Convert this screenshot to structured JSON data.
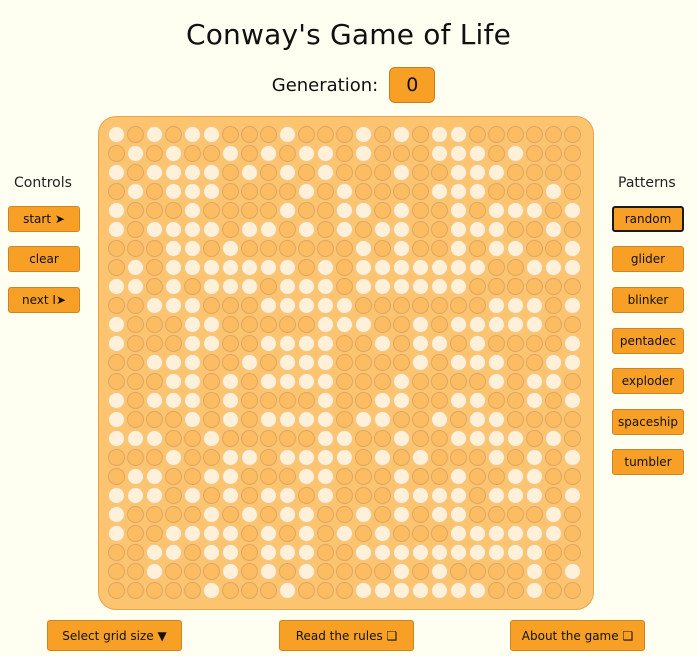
{
  "title": "Conway's Game of Life",
  "generation": {
    "label": "Generation:",
    "value": "0"
  },
  "controls": {
    "heading": "Controls",
    "start": "start ➤",
    "clear": "clear",
    "next": "next I➤"
  },
  "patterns": {
    "heading": "Patterns",
    "items": [
      "random",
      "glider",
      "blinker",
      "pentadec",
      "exploder",
      "spaceship",
      "tumbler"
    ],
    "selected": "random"
  },
  "bottom": {
    "grid_size": "Select grid size ▼",
    "rules": "Read the rules ❏",
    "about": "About the game ❏"
  },
  "colors": {
    "accent": "#f7a025",
    "board": "#fcc46f",
    "alive_cell": "#fff0d9",
    "dead_cell": "#fbbc62",
    "background": "#fefef1"
  },
  "grid": {
    "rows": 25,
    "cols": 25,
    "cells": [
      "1010110001000101011000000",
      "0101001010110100011101000",
      "1011110101010001001110000",
      "0101110000101000011100010",
      "1000100001001101001011101",
      "1011110110101011001110010",
      "0001101000000101001011001",
      "0101111111010111111100111",
      "1101011101110111111000000",
      "0011100011111000000011101",
      "1000110000011100101111100",
      "1000110011110010110100001",
      "0011100101110000101110011",
      "0001101011110001000010110",
      "1011101000010011001100101",
      "1000101011110110010110000",
      "1110010000011001001111010",
      "0001001101111010100010101",
      "0110011000110001001001100",
      "1110101011010001111011101",
      "1000010101100101011000010",
      "1001111010101010001111110",
      "0011011011100111111111100",
      "0010001010100001010000101",
      "0000010001000111111100100"
    ]
  }
}
